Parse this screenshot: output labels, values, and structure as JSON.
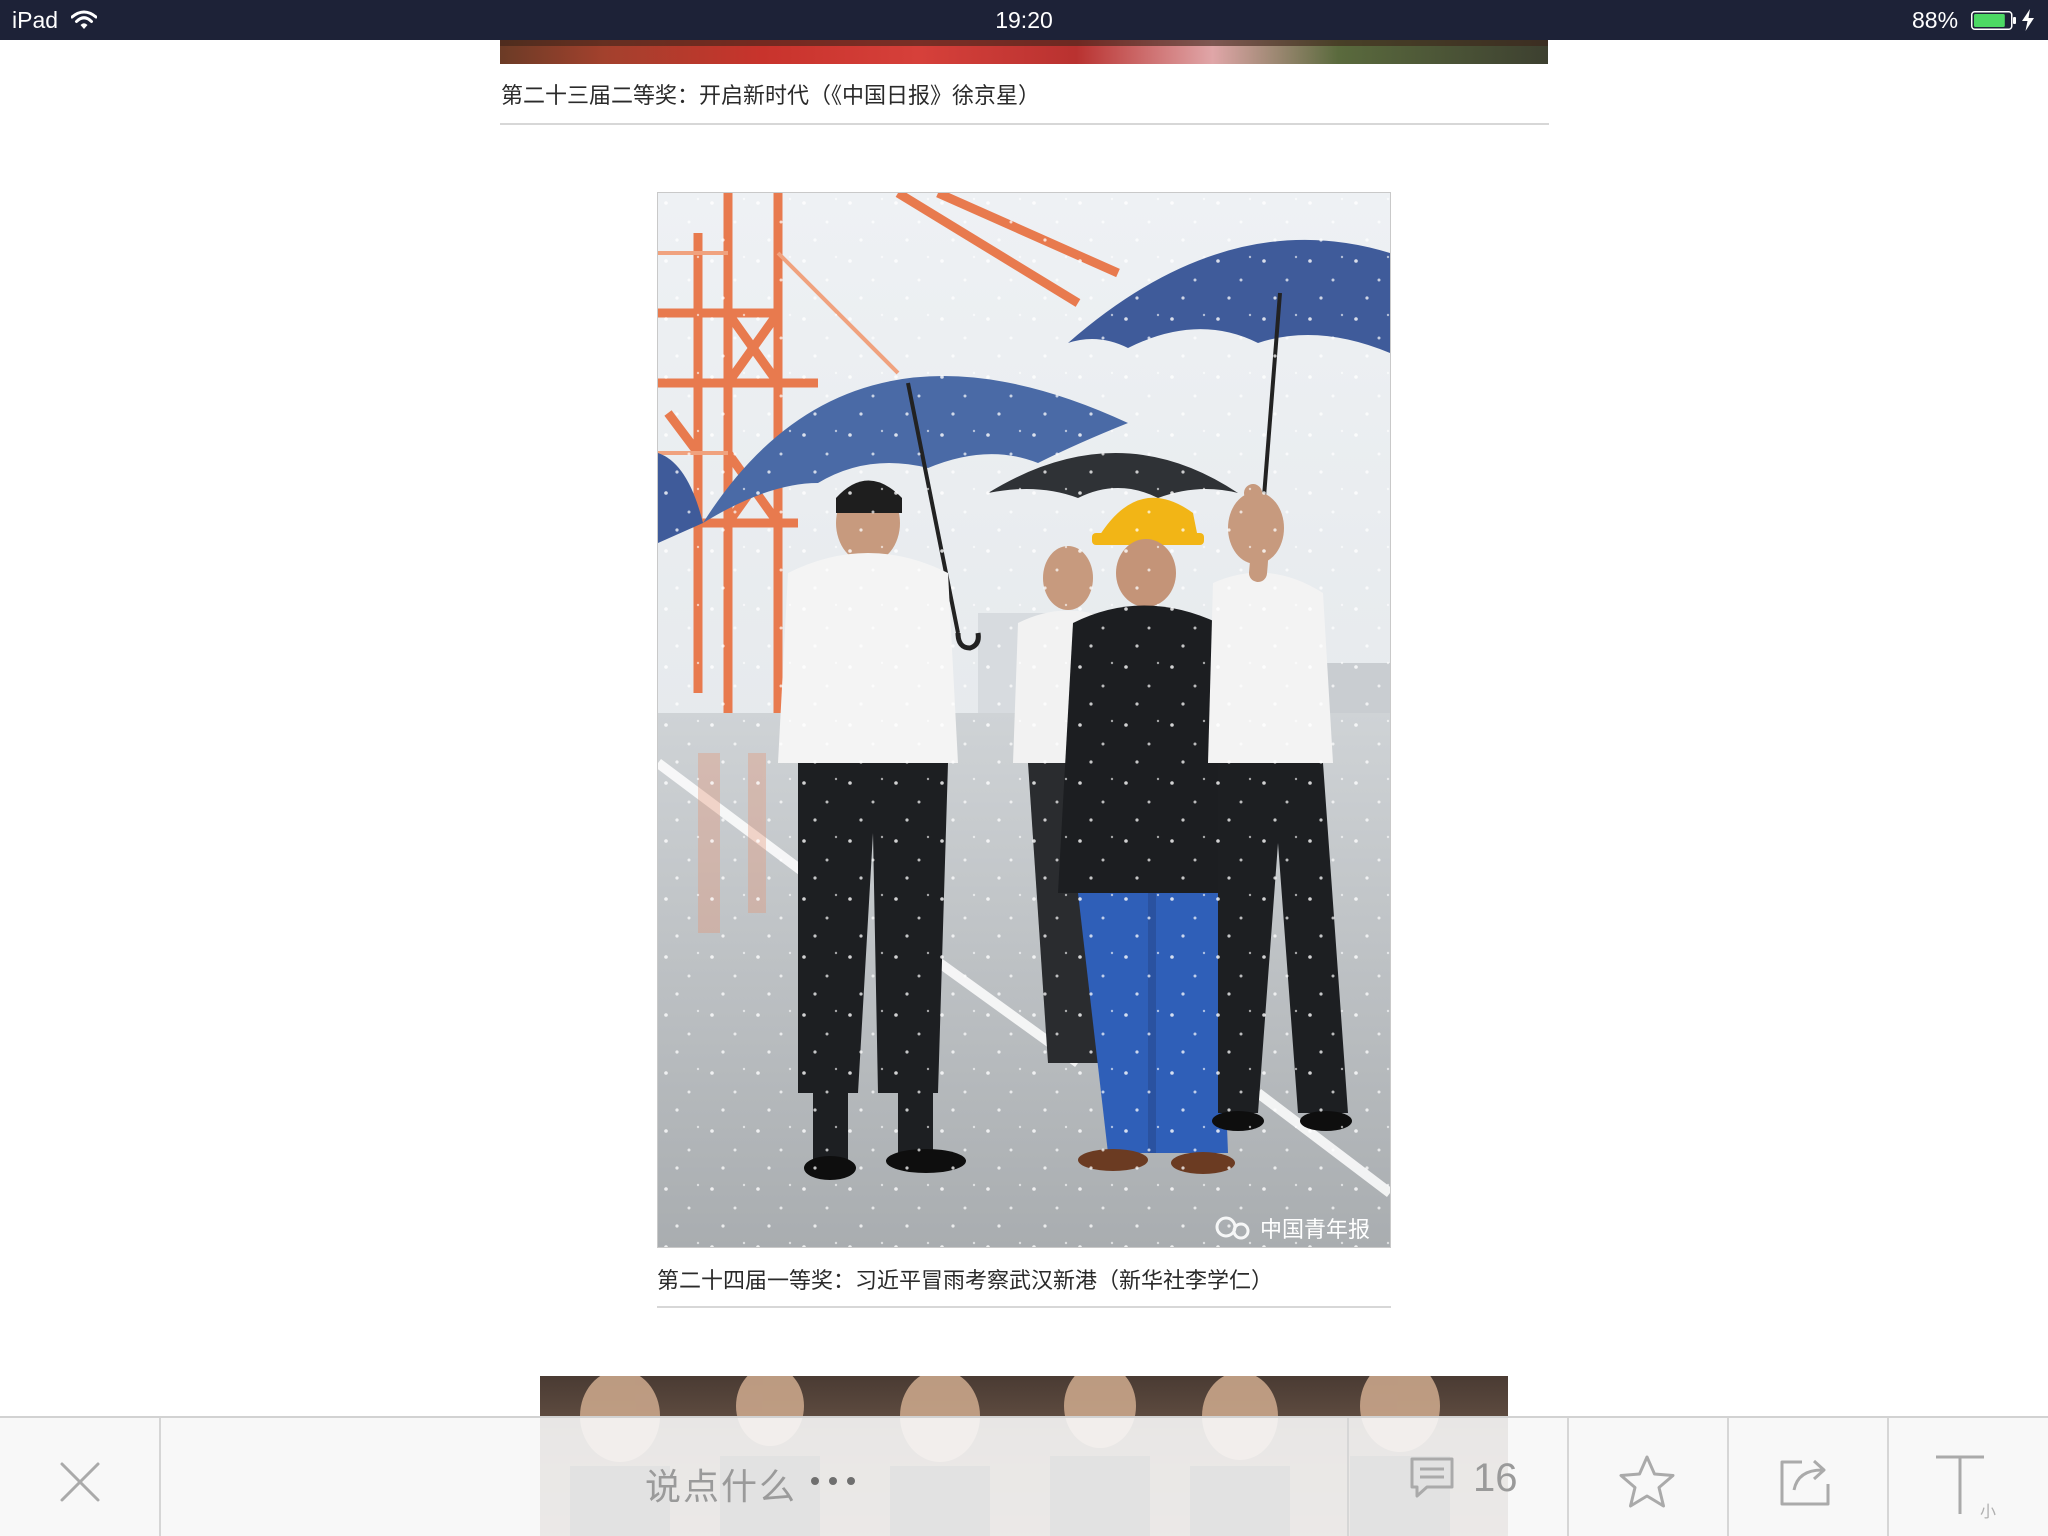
{
  "status_bar": {
    "device": "iPad",
    "time": "19:20",
    "battery_percent": "88%",
    "battery_level": 0.88,
    "charging": true,
    "wifi": "wifi-icon"
  },
  "article": {
    "captions": [
      "第二十三届二等奖：开启新时代（《中国日报》徐京星）",
      "第二十四届一等奖：习近平冒雨考察武汉新港（新华社李学仁）"
    ],
    "watermark": "中国青年报"
  },
  "toolbar": {
    "close_icon": "close-icon",
    "comment_placeholder": "说点什么",
    "comment_count": "16",
    "comment_icon": "comment-bubble-icon",
    "favorite_icon": "star-icon",
    "share_icon": "share-icon",
    "font_icon": "font-size-icon",
    "font_size_label": "小"
  },
  "colors": {
    "status_bar_bg": "#1d2237",
    "battery_green": "#4cd964",
    "toolbar_icon": "#aaaaaa",
    "caption_text": "#2a2a2a",
    "placeholder_text": "#9a9a9a"
  }
}
